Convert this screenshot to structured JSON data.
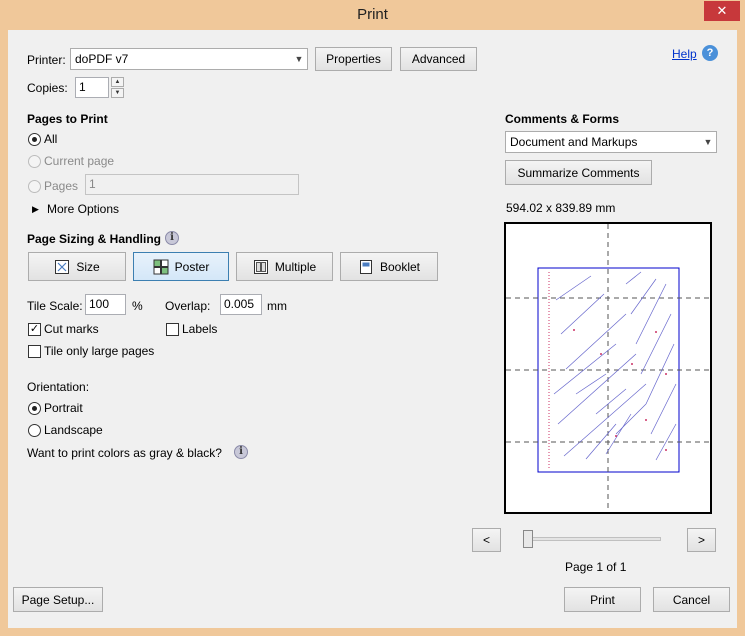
{
  "window": {
    "title": "Print",
    "close_glyph": "✕"
  },
  "printer": {
    "label": "Printer:",
    "value": "doPDF v7",
    "properties_label": "Properties",
    "advanced_label": "Advanced"
  },
  "copies": {
    "label": "Copies:",
    "value": "1"
  },
  "help": {
    "label": "Help",
    "icon": "?"
  },
  "pages_to_print": {
    "heading": "Pages to Print",
    "all_label": "All",
    "current_page_label": "Current page",
    "pages_label": "Pages",
    "pages_value": "1",
    "more_options_label": "More Options"
  },
  "page_sizing": {
    "heading": "Page Sizing & Handling",
    "tabs": [
      {
        "label": "Size",
        "icon": "size-icon"
      },
      {
        "label": "Poster",
        "icon": "poster-icon"
      },
      {
        "label": "Multiple",
        "icon": "multiple-icon"
      },
      {
        "label": "Booklet",
        "icon": "booklet-icon"
      }
    ],
    "selected_tab": "Poster",
    "tile_scale_label": "Tile Scale:",
    "tile_scale_value": "100",
    "tile_scale_unit": "%",
    "overlap_label": "Overlap:",
    "overlap_value": "0.005",
    "overlap_unit": "mm",
    "cut_marks_label": "Cut marks",
    "labels_label": "Labels",
    "tile_only_large_label": "Tile only large pages"
  },
  "orientation": {
    "heading": "Orientation:",
    "portrait_label": "Portrait",
    "landscape_label": "Landscape"
  },
  "gray_question": "Want to print colors as gray & black?",
  "comments_forms": {
    "heading": "Comments & Forms",
    "value": "Document and Markups",
    "summarize_label": "Summarize Comments"
  },
  "preview": {
    "dimensions": "594.02 x 839.89 mm",
    "prev_label": "<",
    "next_label": ">",
    "page_indicator": "Page 1 of 1"
  },
  "footer": {
    "page_setup_label": "Page Setup...",
    "print_label": "Print",
    "cancel_label": "Cancel"
  },
  "colors": {
    "frame": "#f0c89a",
    "client": "#f0f0f0",
    "close": "#c7383b",
    "preview_border": "#0000cc",
    "tile_lines": "#555555",
    "link": "#0033cc"
  }
}
